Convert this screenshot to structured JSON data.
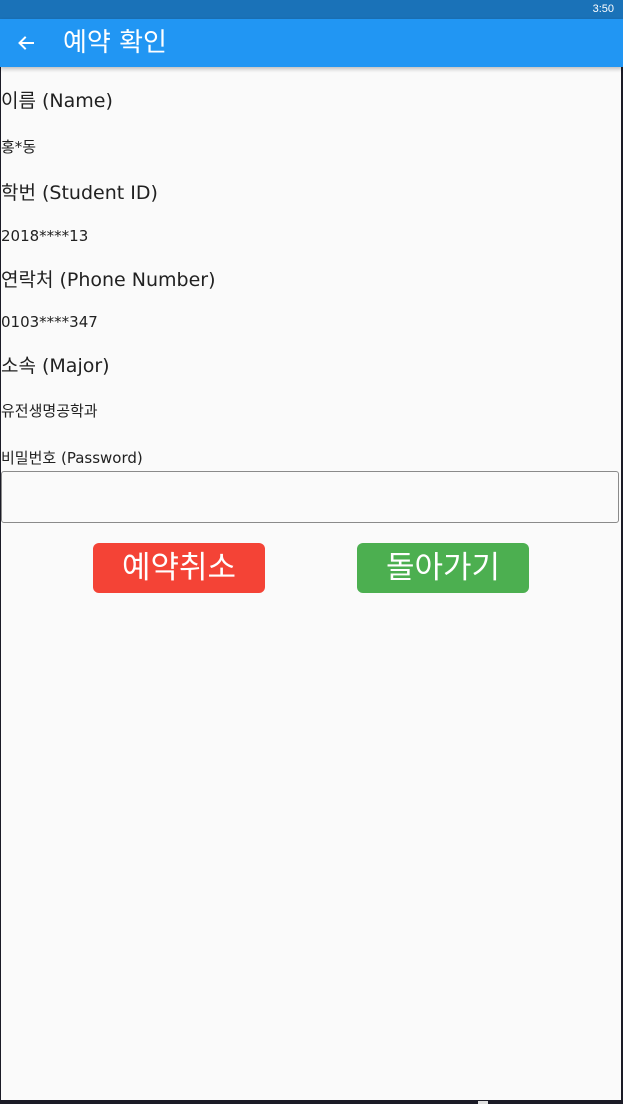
{
  "status_bar": {
    "time": "3:50"
  },
  "app_bar": {
    "title": "예약 확인",
    "back_icon": "arrow-left-icon"
  },
  "fields": [
    {
      "label": "이름 (Name)",
      "value": "홍*동"
    },
    {
      "label": "학번 (Student ID)",
      "value": "2018****13"
    },
    {
      "label": "연락처 (Phone Number)",
      "value": "0103****347"
    },
    {
      "label": "소속 (Major)",
      "value": "유전생명공학과"
    }
  ],
  "password": {
    "label": "비밀번호 (Password)",
    "value": "",
    "placeholder": ""
  },
  "buttons": {
    "cancel_label": "예약취소",
    "back_label": "돌아가기"
  },
  "colors": {
    "status_bar": "#1a72b8",
    "app_bar": "#2196f3",
    "cancel_button": "#f44336",
    "back_button": "#4caf50",
    "background": "#fafafa"
  }
}
